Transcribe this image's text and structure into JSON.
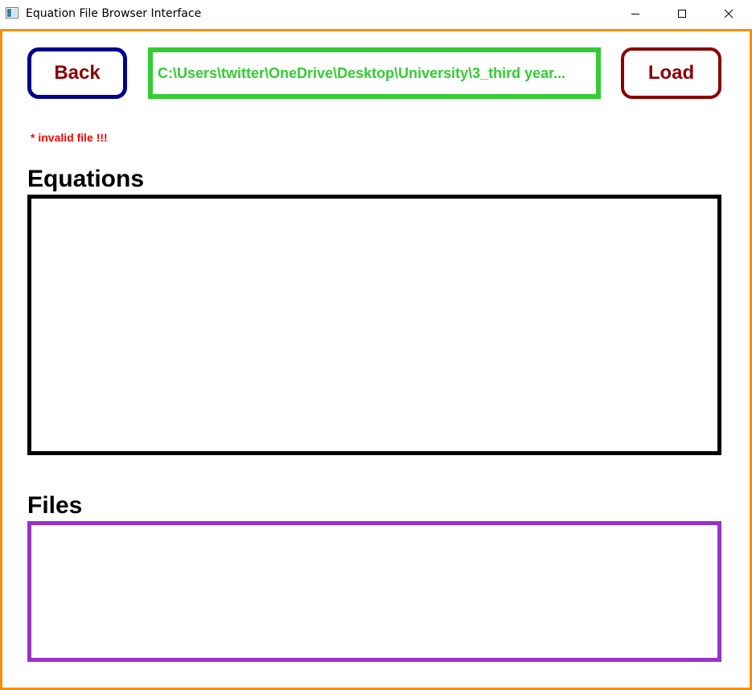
{
  "window": {
    "title": "Equation File Browser Interface",
    "icon": "app-window-icon"
  },
  "toolbar": {
    "back_label": "Back",
    "load_label": "Load",
    "path_value": "C:\\Users\\twitter\\OneDrive\\Desktop\\University\\3_third year..."
  },
  "status": {
    "error_text": "* invalid file !!!"
  },
  "equations": {
    "heading": "Equations",
    "items": []
  },
  "files": {
    "heading": "Files",
    "items": []
  },
  "colors": {
    "frame": "#f5900c",
    "back_border": "#00008b",
    "button_text": "#8b0000",
    "path": "#32cd32",
    "error": "#ff0000",
    "equations_border": "#000000",
    "files_border": "#9932cc"
  }
}
